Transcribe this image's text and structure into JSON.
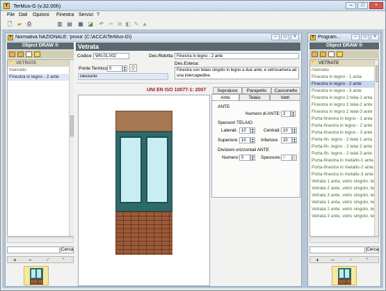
{
  "app": {
    "title": "TerMus-G (v.32.00h)"
  },
  "menu": [
    "File",
    "Dati",
    "Opzioni",
    "Finestra",
    "Servizi",
    "?"
  ],
  "left_window": {
    "title": "Normativa NAZIONALE: 'prova'   (C:\\ACCA\\TerMus-G\\)",
    "object_draw": "Object DRAW ®",
    "tree": [
      "VETRATE",
      "riservato",
      "Finestra in legno - 2 ante"
    ],
    "search_label": "Cerca",
    "add": "+",
    "remove": "−",
    "confirm": "✓",
    "cancel": "×"
  },
  "form": {
    "header": "Vetrata",
    "codice_label": "Codice:",
    "codice_value": "WN.01.002",
    "des_ridotta_label": "Des.Ridotta:",
    "des_ridotta_value": "Finestra in legno - 2 ante",
    "des_estesa_label": "Des.Estesa:",
    "des_estesa_value": "Finestra con telaio singolo in legno a due ante, e vetrocamera ad una intercapedine.",
    "ponte_label": "Ponte Termico:",
    "ponte_value": "0",
    "ponte_none": "nessuno",
    "norm": "UNI EN ISO 10077-1: 2007",
    "tabs_top": [
      "Sopraluce",
      "Parapetto",
      "Cassonetto"
    ],
    "tabs_bottom": [
      "Ante",
      "Telaio",
      "Vetri"
    ],
    "ante_group": "ANTE",
    "num_ante_label": "Numero di ANTE:",
    "num_ante_value": "2",
    "spessori_group": "Spessori TELAIO",
    "laterali_label": "Laterali:",
    "laterali_value": "10",
    "centrali_label": "Centrali:",
    "centrali_value": "10",
    "superiore_label": "Superiore:",
    "superiore_value": "10",
    "inferiore_label": "Inferiore:",
    "inferiore_value": "20",
    "divisioni_group": "Divisioni orizzontali ANTE",
    "numero_label": "Numero:",
    "numero_value": "0",
    "spessore_label": "Spessore:",
    "spessore_value": "0"
  },
  "right_window": {
    "title": "Program...",
    "object_draw": "Object DRAW ®",
    "items": [
      "VETRATE",
      "riservato",
      "Finestra in legno - 1 anta",
      "Finestra in legno - 2 ante",
      "Finestra in legno - 3 ante",
      "Finestra in legno 2 telai-1 anta",
      "Finestra in legno 2 telai-2 ante",
      "Finestra in legno 2 telai-3 ante",
      "Porta-finestra in legno - 1 anta",
      "Porta-finestra in legno - 2 ante",
      "Porta-finestra in legno - 3 ante",
      "Porta-fin. legno - 2 telai 1 anta",
      "Porta-fin. legno - 2 telai 2 ante",
      "Porta-fin. legno - 2 telai 3 ante",
      "Porta-finestra in metallo-1 anta",
      "Porta-finestra in metallo-2 ante",
      "Porta-finestra in metallo-3 ante",
      "Vetrata 1 anta, vetro singolo, tel",
      "Vetrata 2 ante, vetro singolo, tel",
      "Vetrata 3 ante, vetro singolo, tel",
      "Vetrata 1 anta, vetro singolo, tel",
      "Vetrata 2 ante, vetro singolo, tel",
      "Vetrata 3 ante, vetro singolo, tel"
    ],
    "search_label": "Cerca",
    "add": "+",
    "remove": "−",
    "confirm": "✓",
    "cancel": "×"
  }
}
